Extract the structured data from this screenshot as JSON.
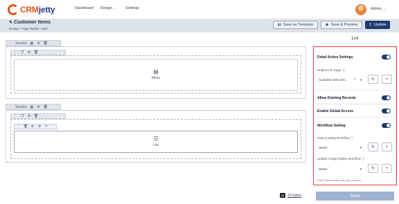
{
  "app": {
    "logo_prefix": "CRM",
    "logo_suffix": "jetty",
    "nav": [
      {
        "label": "Dashboard"
      },
      {
        "label": "Design"
      },
      {
        "label": "Settings"
      }
    ],
    "user_label": "Admin"
  },
  "page": {
    "title": "Customer Items",
    "breadcrumb": "Design  •  Page Builder  •  Edit"
  },
  "toolbar": {
    "save_template": "Save as Template",
    "save_preview": "Save & Preview",
    "update": "Update"
  },
  "canvas": {
    "section_label": "Section",
    "widget_menu": "Menu",
    "widget_list": "List",
    "js_editor": "JS Editor"
  },
  "panel": {
    "title": "List",
    "detail_action": "Detail Action Settings",
    "redirect_label": "Redirect To Page",
    "redirect_value": "Customer Item Det...",
    "allow_delete": "Allow Deleting Records",
    "global_access": "Enable Global Access",
    "workflow": "Workflow Setting",
    "data_loading_label": "Data Loading Workflow",
    "data_loading_value": "Select",
    "assign_rights_label": "Update Assign Rights Workflow",
    "assign_rights_value": "Select",
    "note": "Note: Please select any one workflow.",
    "save": "Save"
  },
  "colors": {
    "brand_orange": "#e2541b",
    "brand_navy": "#1e3a6e",
    "highlight_red": "#e53935"
  }
}
